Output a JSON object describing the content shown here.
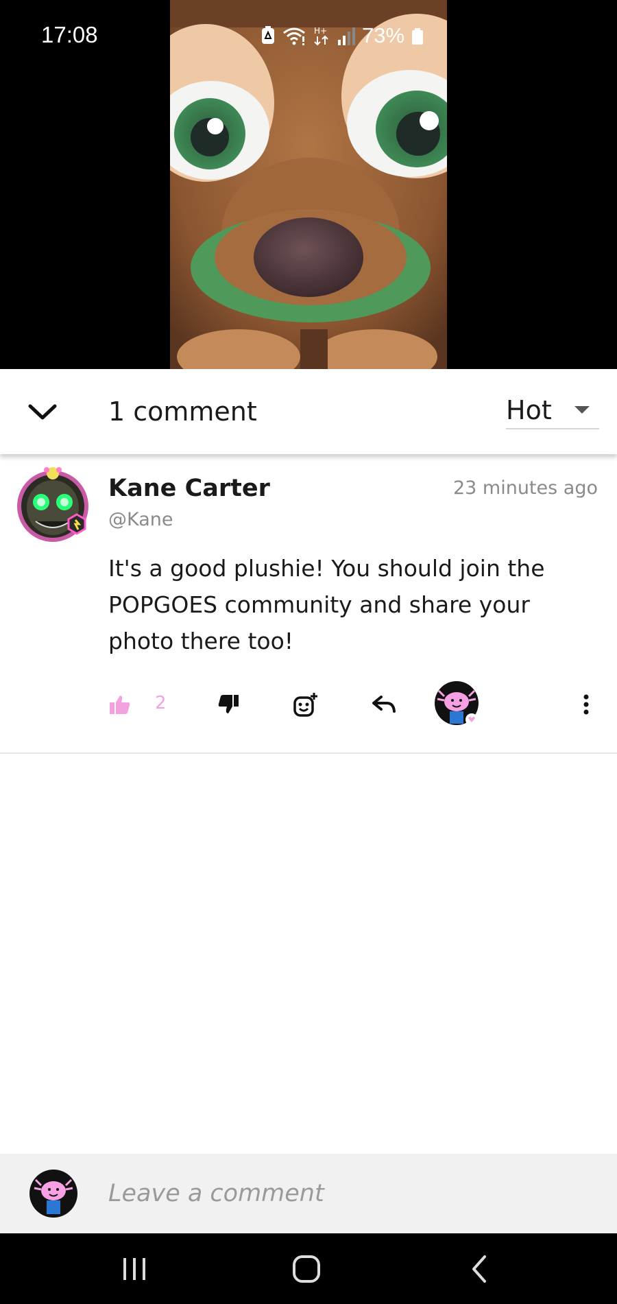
{
  "status_bar": {
    "time": "17:08",
    "battery": "73%",
    "icons": [
      "battery-saver-icon",
      "wifi-icon",
      "hplus-data-icon",
      "signal-icon",
      "battery-icon"
    ]
  },
  "video": {
    "subject": "plush-toy-photo"
  },
  "comments_header": {
    "collapse_icon": "chevron-down-icon",
    "count_label": "1 comment",
    "sort_value": "Hot",
    "sort_icon": "caret-down-icon"
  },
  "comments": [
    {
      "author": "Kane Carter",
      "handle": "@Kane",
      "time": "23 minutes ago",
      "text": "It's a good plushie! You should join the POPGOES community and share your photo there too!",
      "likes": "2",
      "actions": [
        "thumbs-up-icon",
        "thumbs-down-icon",
        "add-emoji-icon",
        "reply-icon",
        "reactor-avatar",
        "more-options-icon"
      ]
    }
  ],
  "comment_bar": {
    "placeholder": "Leave a comment"
  },
  "nav_bar": {
    "buttons": [
      "recents-icon",
      "home-icon",
      "back-icon"
    ]
  },
  "colors": {
    "like_accent": "#f3a1df",
    "header_shadow": "#d6d6d6",
    "comment_bar_bg": "#f1f1f1",
    "muted_text": "#8a8a8a"
  }
}
